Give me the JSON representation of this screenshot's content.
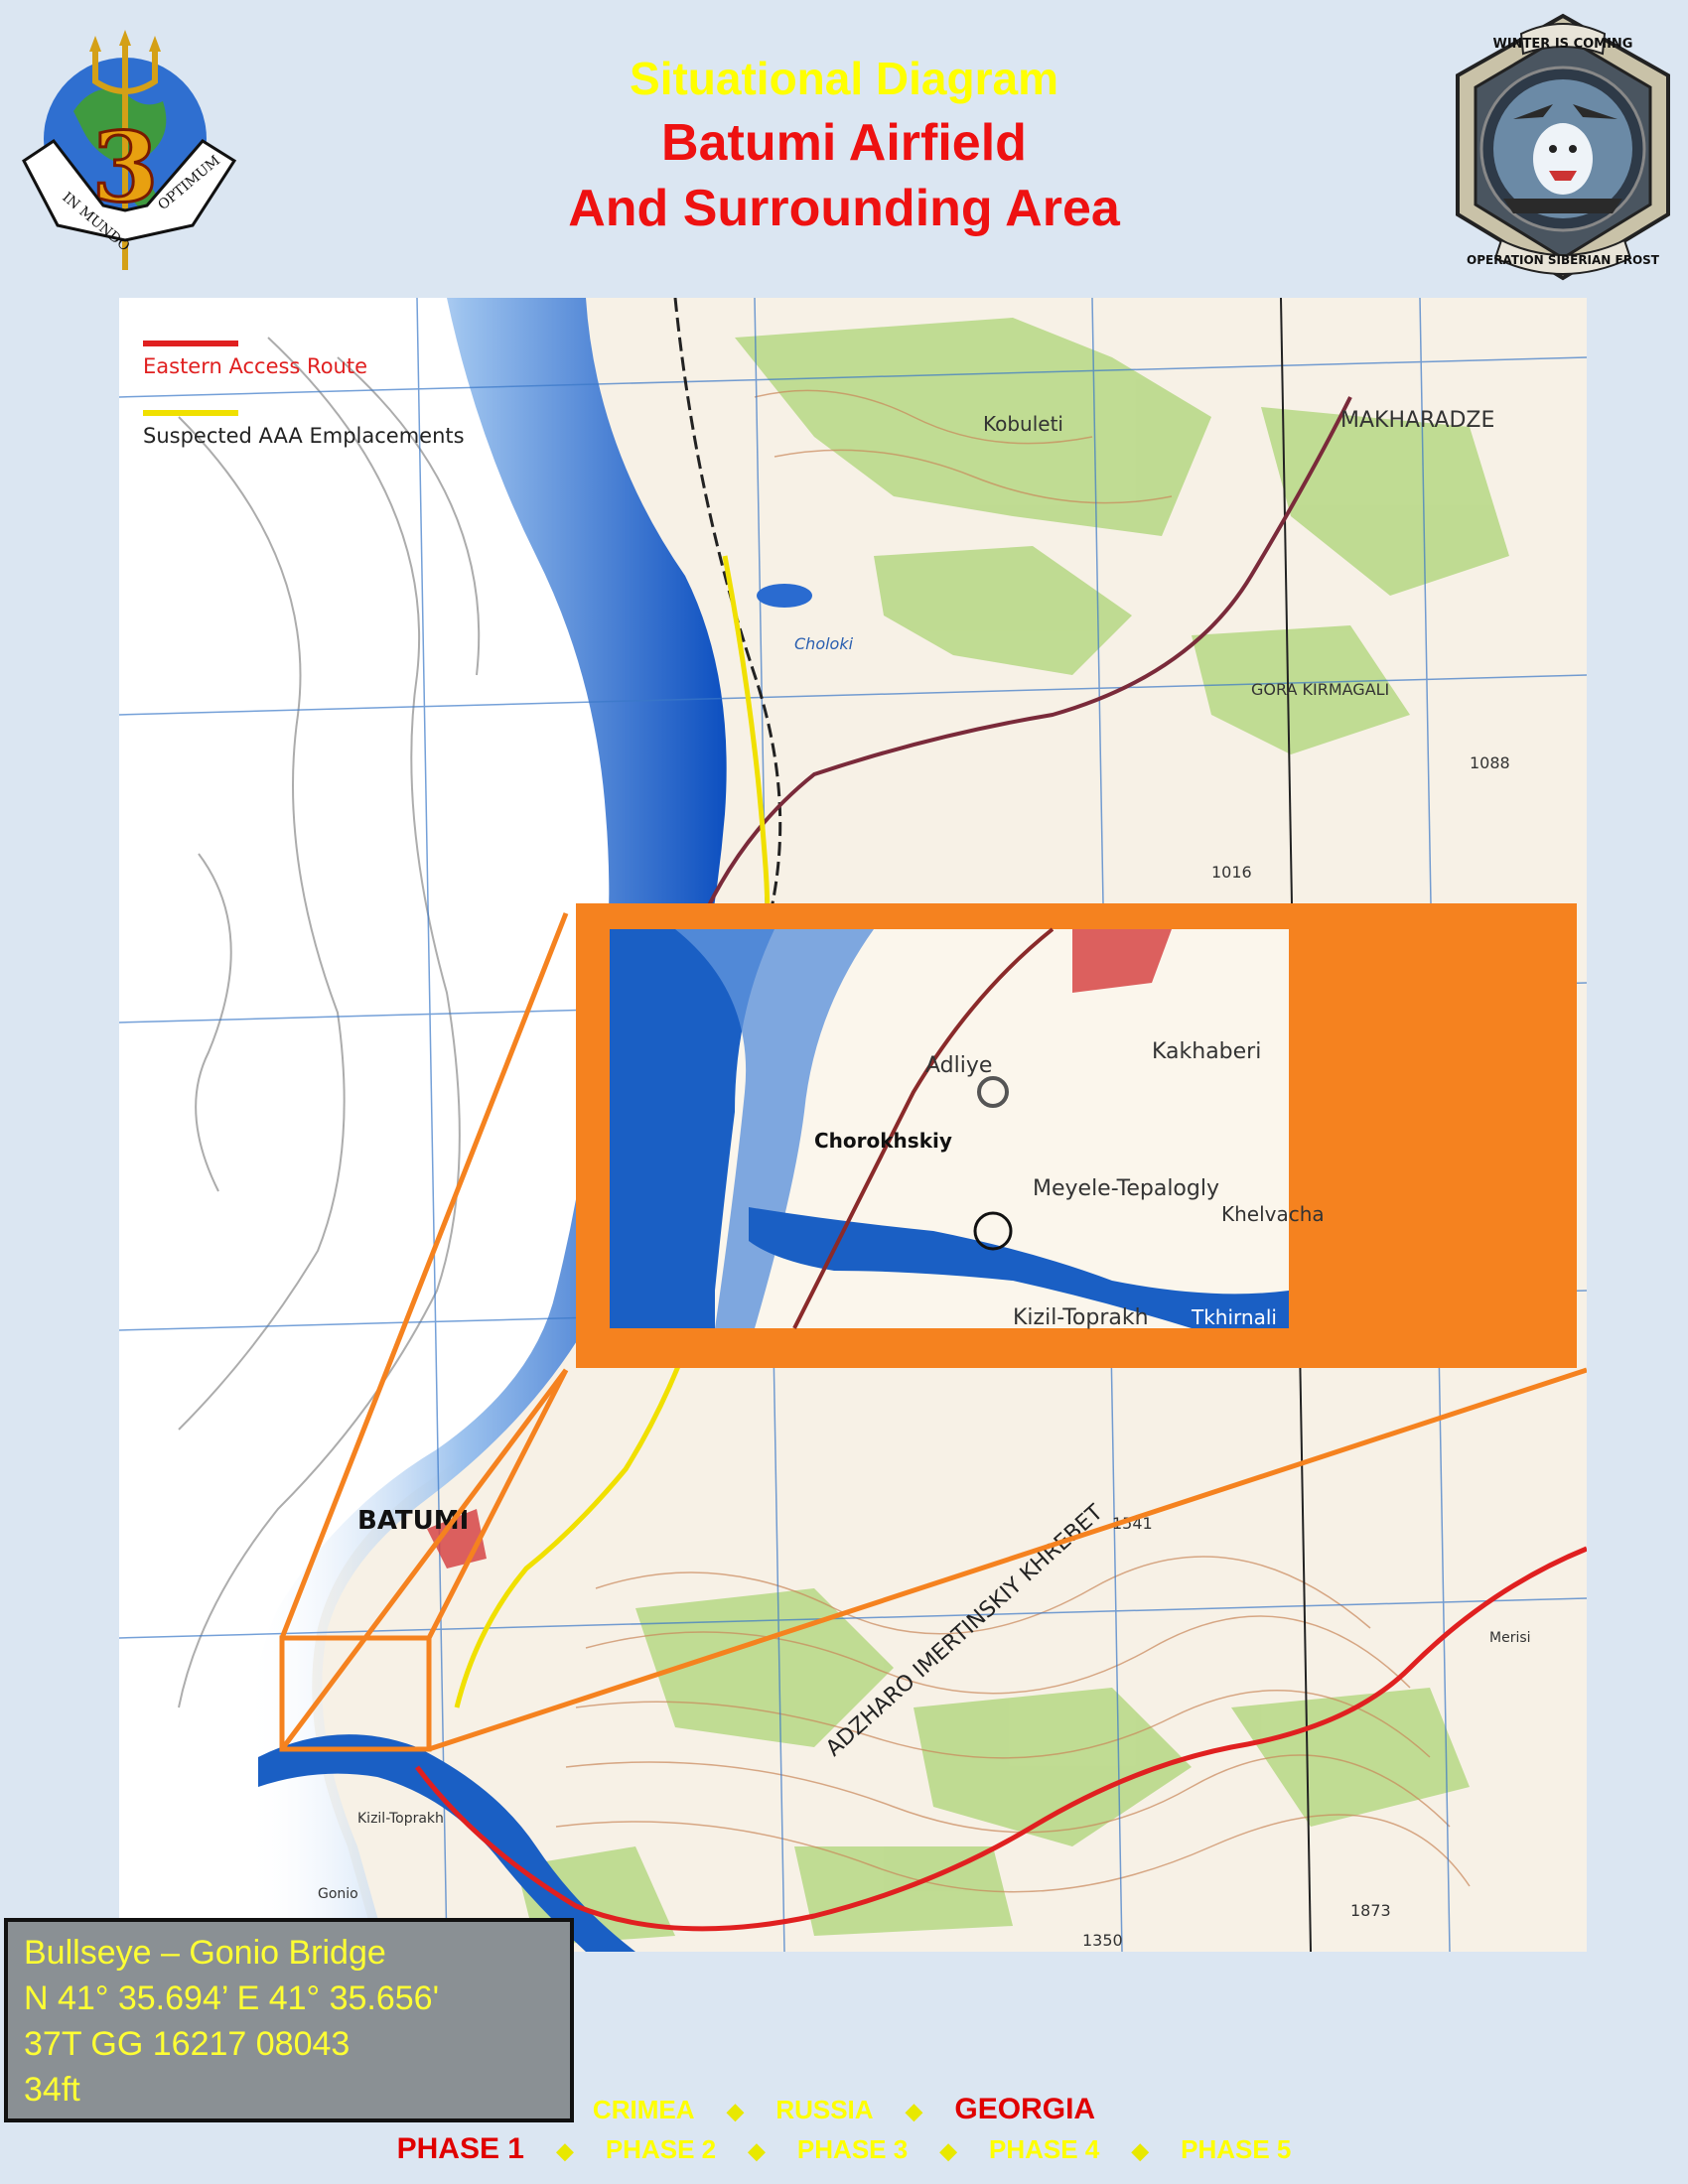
{
  "header": {
    "title_line1": "Situational Diagram",
    "title_line2": "Batumi Airfield",
    "title_line3": "And Surrounding Area"
  },
  "logo_left": {
    "numeral": "3",
    "motto_left": "IN MUNDO",
    "motto_right": "OPTIMUM"
  },
  "logo_right": {
    "top_text": "WINTER IS COMING",
    "bottom_text": "OPERATION SIBERIAN FROST"
  },
  "legend": {
    "items": [
      {
        "label": "Eastern Access Route",
        "color": "#e02020"
      },
      {
        "label": "Suspected AAA Emplacements",
        "color": "#f0e000"
      }
    ]
  },
  "map_labels": {
    "batumi": "BATUMI",
    "makharadze": "MAKHARADZE",
    "kobuleti": "Kobuleti",
    "choloki": "Choloki",
    "ridge": "ADZHARO IMERTINSKIY KHREBET",
    "inset_adliye": "Adliye",
    "inset_chorokhskiy": "Chorokhskiy",
    "inset_kakhaberi": "Kakhaberi",
    "inset_meyele": "Meyele-Tepalogly",
    "inset_kizil": "Kizil-Toprakh",
    "inset_tkhirnali": "Tkhirnali",
    "inset_khelvachauri": "Khelvacha",
    "gora_kirmagali": "GORA KIRMAGALI",
    "elev_1088": "1088",
    "elev_1016": "1016",
    "elev_1541": "1541",
    "elev_1350": "1350",
    "elev_1873": "1873",
    "kizil_small": "Kizil-Toprakh",
    "gonio": "Gonio",
    "merisi": "Merisi"
  },
  "bullseye": {
    "line1": "Bullseye – Gonio Bridge",
    "line2": "N 41° 35.694’   E 41° 35.656'",
    "line3": "37T GG 16217 08043",
    "line4": "34ft"
  },
  "nav": {
    "regions": [
      {
        "label": "CRIMEA",
        "active": false
      },
      {
        "label": "RUSSIA",
        "active": false
      },
      {
        "label": "GEORGIA",
        "active": true
      }
    ],
    "phases": [
      {
        "label": "PHASE 1",
        "active": true
      },
      {
        "label": "PHASE 2",
        "active": false
      },
      {
        "label": "PHASE 3",
        "active": false
      },
      {
        "label": "PHASE 4",
        "active": false
      },
      {
        "label": "PHASE 5",
        "active": false
      }
    ]
  },
  "colors": {
    "title_yellow": "#ffff00",
    "title_red": "#ee1111",
    "sea_blue": "#1a5fc4",
    "callout_orange": "#f5821f",
    "route_red": "#e02020",
    "aaa_yellow": "#f0e000"
  }
}
